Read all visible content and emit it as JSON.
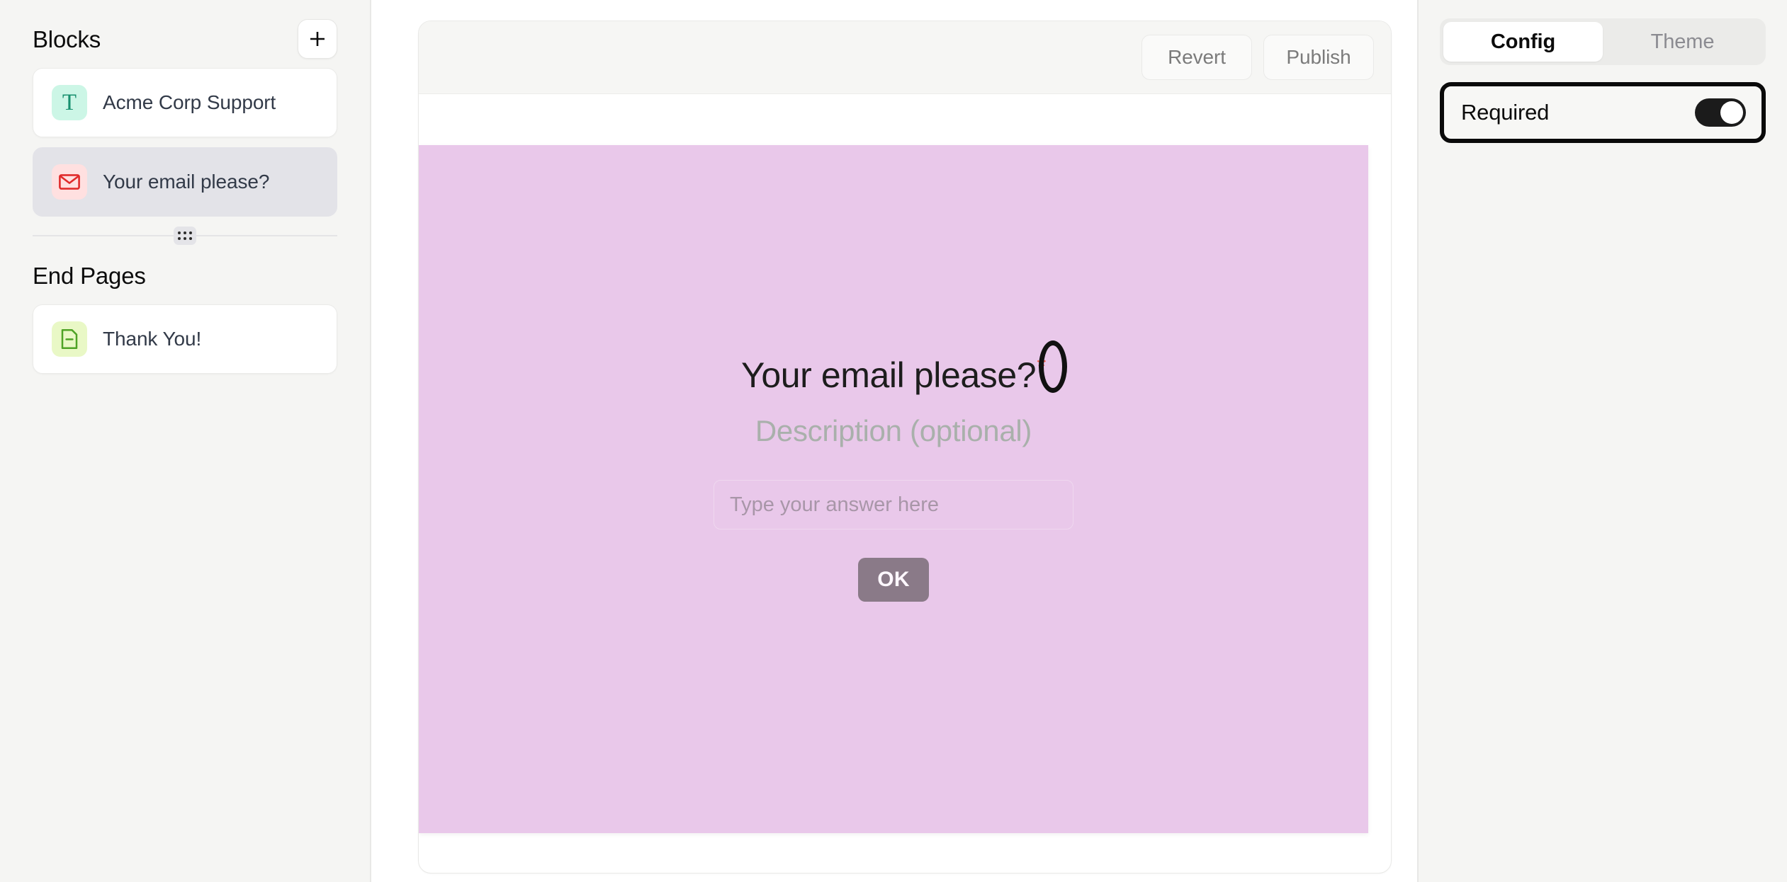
{
  "sidebar": {
    "blocks_title": "Blocks",
    "add_button_label": "+",
    "add_icon": "plus-icon",
    "blocks": [
      {
        "label": "Acme Corp Support",
        "icon": "text-block-icon",
        "glyph": "T",
        "selected": false
      },
      {
        "label": "Your email please?",
        "icon": "email-block-icon",
        "glyph": "envelope",
        "selected": true
      }
    ],
    "drag_handle_icon": "drag-handle-icon",
    "end_pages_title": "End Pages",
    "end_pages": [
      {
        "label": "Thank You!",
        "icon": "document-block-icon",
        "glyph": "document"
      }
    ]
  },
  "toolbar": {
    "revert_label": "Revert",
    "publish_label": "Publish"
  },
  "preview": {
    "question_title": "Your email please?",
    "required_marker": "*",
    "description": "Description (optional)",
    "input_placeholder": "Type your answer here",
    "input_value": "",
    "ok_label": "OK",
    "background_color": "#e9c8ea",
    "ok_button_color": "#8a7a88",
    "required_marker_color": "#f4604f"
  },
  "right_panel": {
    "tabs": [
      {
        "label": "Config",
        "active": true
      },
      {
        "label": "Theme",
        "active": false
      }
    ],
    "settings": [
      {
        "label": "Required",
        "value": "on",
        "highlighted": true
      }
    ]
  },
  "annotations": {
    "required_marker_circle": "ellipse-highlight",
    "required_row_box": "rect-highlight",
    "color": "#0a0a0a"
  }
}
